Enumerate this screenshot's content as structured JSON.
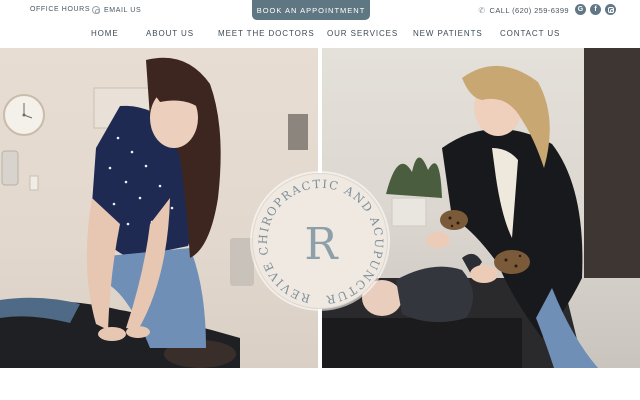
{
  "topbar": {
    "office_hours": "OFFICE HOURS",
    "email": "EMAIL US",
    "book_label": "BOOK AN APPOINTMENT",
    "phone": "CALL (620) 259-6399",
    "socials": [
      "google-icon",
      "facebook-icon",
      "instagram-icon"
    ]
  },
  "nav": {
    "items": [
      {
        "label": "HOME"
      },
      {
        "label": "ABOUT US"
      },
      {
        "label": "MEET THE DOCTORS"
      },
      {
        "label": "OUR SERVICES"
      },
      {
        "label": "NEW PATIENTS"
      },
      {
        "label": "CONTACT US"
      }
    ]
  },
  "hero": {
    "logo": {
      "monogram": "R",
      "text": "REVIVE CHIROPRACTIC AND ACUPUNCTURE"
    },
    "left_photo": "chiropractor-adjusting-patient",
    "right_photo": "chiropractor-adjusting-infant"
  },
  "colors": {
    "accent": "#5f7782",
    "text": "#3b4a55",
    "logo_bg": "#efe9e2",
    "logo_text": "#7e8f99"
  }
}
